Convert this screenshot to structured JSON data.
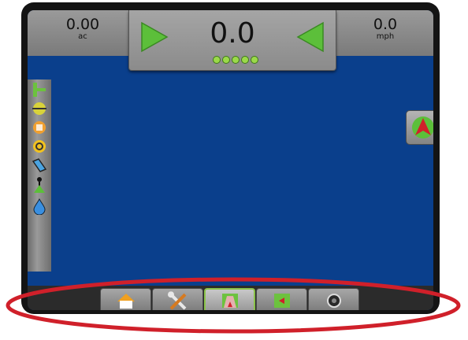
{
  "topbar": {
    "area": {
      "value": "0.00",
      "unit": "ac"
    },
    "center": {
      "value": "0.0",
      "led_count": 5
    },
    "speed": {
      "value": "0.0",
      "unit": "mph"
    },
    "left_arrow_icon": "steer-left-icon",
    "right_arrow_icon": "steer-right-icon",
    "accent_color": "#5cbf3a"
  },
  "left_rail": {
    "icons": [
      "implement-status-icon",
      "boom-status-icon",
      "rate-control-icon",
      "auto-steer-icon",
      "tilt-icon",
      "gnss-antenna-icon",
      "tank-level-icon"
    ]
  },
  "view_button": {
    "icon": "vehicle-view-icon"
  },
  "bottom_nav": {
    "tabs": [
      {
        "name": "home",
        "icon": "home-icon",
        "active": false
      },
      {
        "name": "configuration",
        "icon": "tools-icon",
        "active": true
      },
      {
        "name": "vehicle-view",
        "icon": "vehicle-view-tab-icon",
        "active": false
      },
      {
        "name": "field-view",
        "icon": "field-view-icon",
        "active": false
      },
      {
        "name": "full-screen-camera",
        "icon": "camera-icon",
        "active": false
      }
    ]
  },
  "colors": {
    "screen_bg": "#0a3f8c",
    "highlight": "#d0202a",
    "active_tab_border": "#8bc34a"
  }
}
